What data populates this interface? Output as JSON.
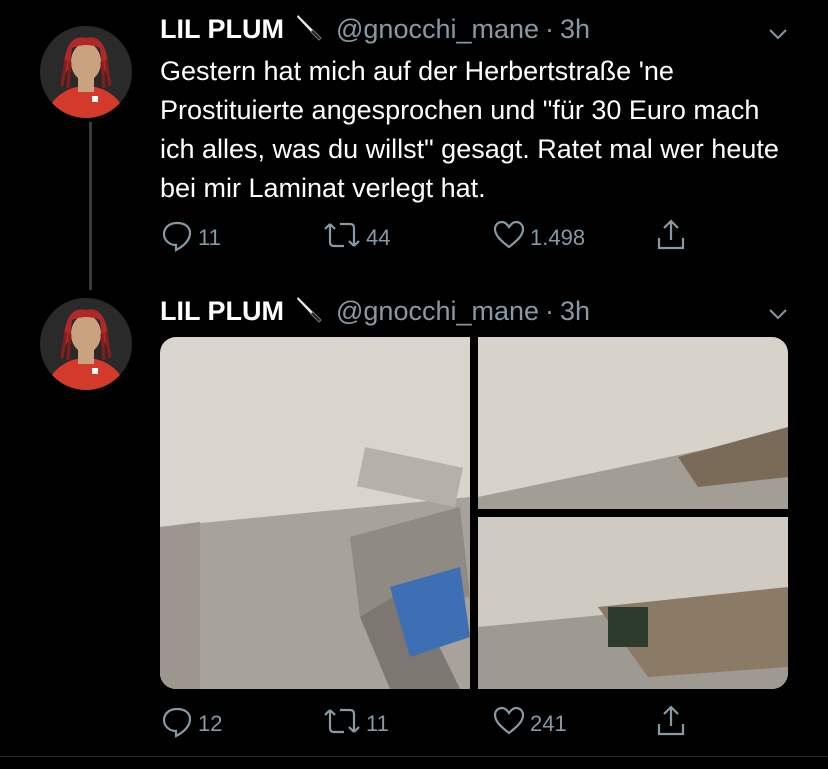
{
  "tweets": [
    {
      "display_name": "LIL PLUM",
      "handle": "@gnocchi_mane",
      "separator": "·",
      "time": "3h",
      "text": "Gestern hat mich auf der Herbertstraße 'ne Prostituierte angesprochen und \"für 30 Euro mach ich alles, was du willst\" gesagt. Ratet mal wer heute bei mir Laminat verlegt hat.",
      "replies": "11",
      "retweets": "44",
      "likes": "1.498"
    },
    {
      "display_name": "LIL PLUM",
      "handle": "@gnocchi_mane",
      "separator": "·",
      "time": "3h",
      "replies": "12",
      "retweets": "11",
      "likes": "241"
    }
  ],
  "icons": {
    "name_emoji": "knife-icon",
    "menu": "chevron-down-icon",
    "reply": "reply-icon",
    "retweet": "retweet-icon",
    "like": "heart-icon",
    "share": "share-icon"
  },
  "colors": {
    "background": "#000000",
    "text": "#ffffff",
    "secondary": "#8899a6",
    "thread_line": "#3a3a3a"
  }
}
